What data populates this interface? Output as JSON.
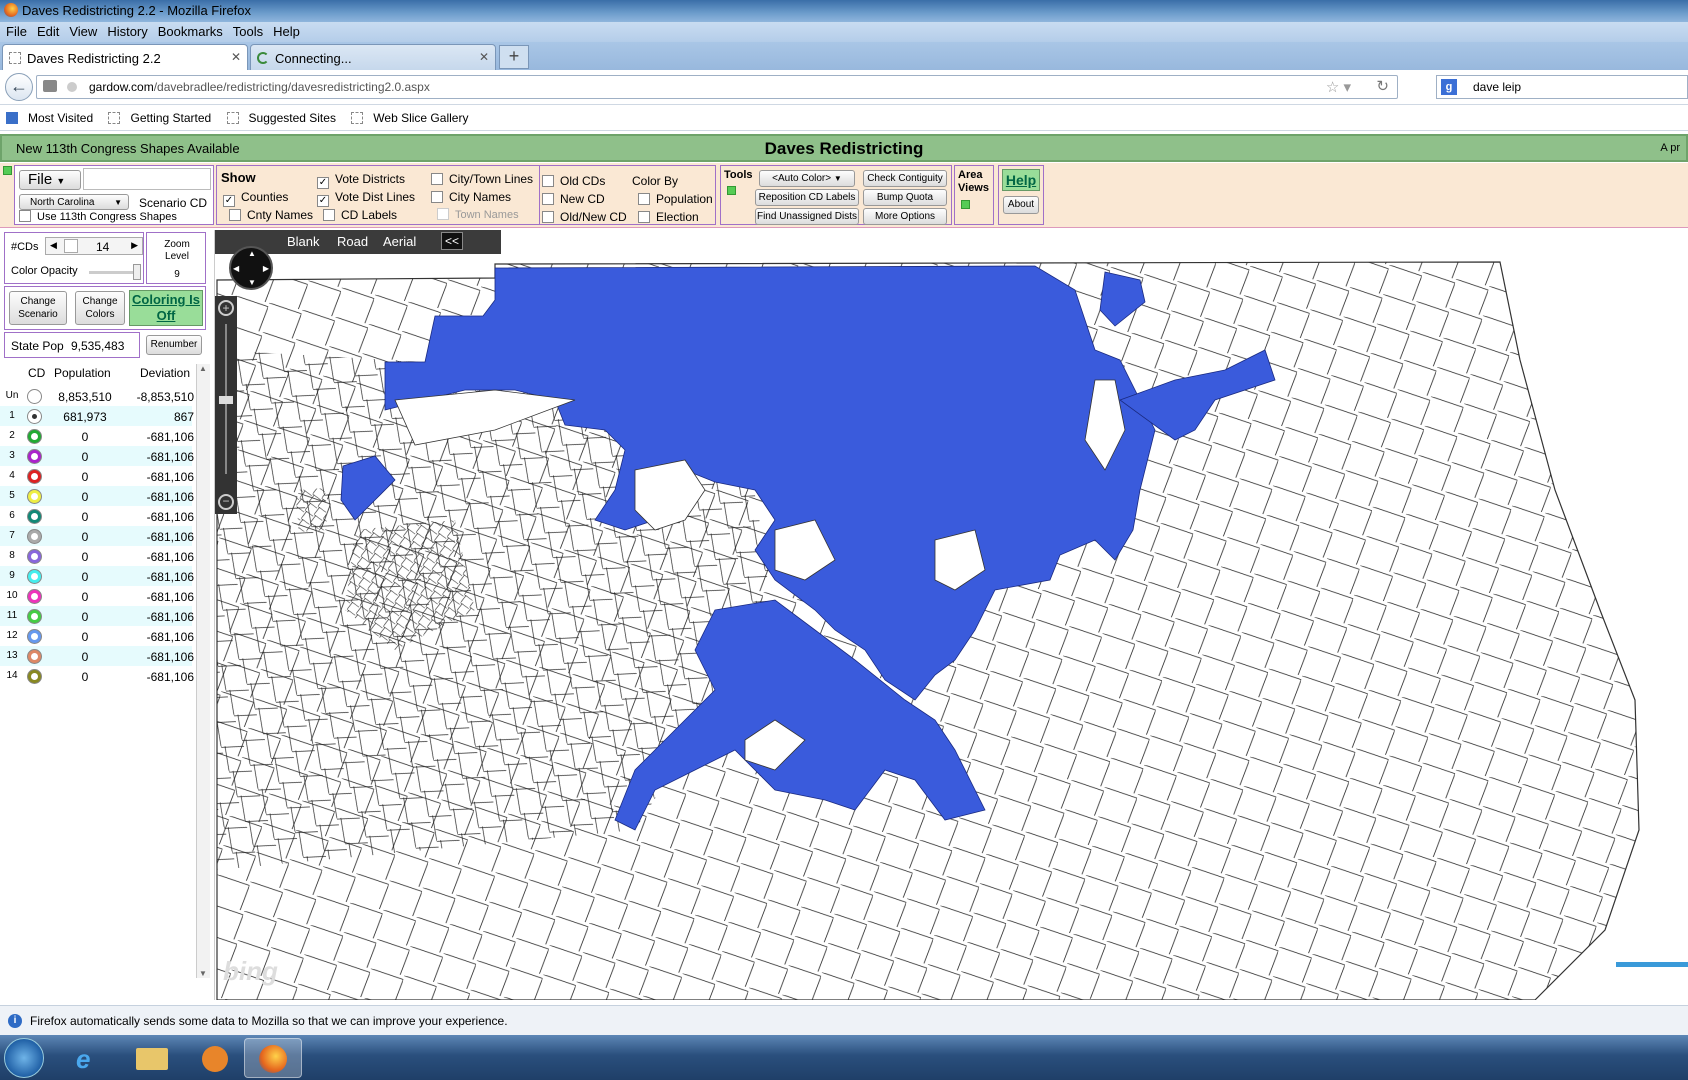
{
  "window": {
    "title": "Daves Redistricting 2.2 - Mozilla Firefox"
  },
  "menu": [
    "File",
    "Edit",
    "View",
    "History",
    "Bookmarks",
    "Tools",
    "Help"
  ],
  "tabs": [
    {
      "label": "Daves Redistricting 2.2",
      "active": true
    },
    {
      "label": "Connecting...",
      "active": false
    }
  ],
  "url": {
    "domain": "gardow.com",
    "path": "/davebradlee/redistricting/davesredistricting2.0.aspx"
  },
  "search": {
    "value": "dave leip"
  },
  "bookmarks": [
    "Most Visited",
    "Getting Started",
    "Suggested Sites",
    "Web Slice Gallery"
  ],
  "app": {
    "notice": "New 113th Congress Shapes Available",
    "title": "Daves Redistricting",
    "right_text": "A pr"
  },
  "file_panel": {
    "file_label": "File",
    "state": "North Carolina",
    "scenario": "Scenario CD",
    "use113": "Use 113th Congress Shapes"
  },
  "show_panel": {
    "title": "Show",
    "items": [
      {
        "label": "Vote Districts",
        "checked": true
      },
      {
        "label": "City/Town Lines",
        "checked": false
      },
      {
        "label": "Counties",
        "checked": true
      },
      {
        "label": "Vote Dist Lines",
        "checked": true
      },
      {
        "label": "City Names",
        "checked": false
      },
      {
        "label": "Cnty Names",
        "checked": false
      },
      {
        "label": "CD Labels",
        "checked": false
      },
      {
        "label": "Town Names",
        "checked": false
      }
    ]
  },
  "cd_panel": {
    "items": [
      {
        "label": "Old CDs",
        "checked": false
      },
      {
        "label": "New CD",
        "checked": false
      },
      {
        "label": "Old/New CD",
        "checked": false
      }
    ],
    "color_by": "Color By",
    "color_options": [
      {
        "label": "Population",
        "checked": false
      },
      {
        "label": "Election",
        "checked": false
      }
    ]
  },
  "tools": {
    "title": "Tools",
    "auto_color": "<Auto Color>",
    "check_contiguity": "Check Contiguity",
    "reposition": "Reposition CD Labels",
    "bump_quota": "Bump Quota",
    "find_unassigned": "Find Unassigned Dists",
    "more_options": "More Options"
  },
  "area_views": "Area Views",
  "help": "Help",
  "about": "About",
  "left": {
    "cds_label": "#CDs",
    "cds_value": "14",
    "zoom_label": "Zoom Level",
    "zoom_value": "9",
    "opacity_label": "Color Opacity",
    "change_scenario": "Change Scenario",
    "change_colors": "Change Colors",
    "coloring": "Coloring Is Off",
    "state_pop_label": "State Pop",
    "state_pop": "9,535,483",
    "renumber": "Renumber"
  },
  "table": {
    "headers": [
      "CD",
      "Population",
      "Deviation"
    ],
    "rows": [
      {
        "cd": "Un",
        "color": "#ffffff",
        "pop": "8,853,510",
        "dev": "-8,853,510",
        "selected": false
      },
      {
        "cd": "1",
        "color": "#3355dd",
        "pop": "681,973",
        "dev": "867",
        "selected": true
      },
      {
        "cd": "2",
        "color": "#22aa33",
        "pop": "0",
        "dev": "-681,106",
        "selected": false
      },
      {
        "cd": "3",
        "color": "#aa22cc",
        "pop": "0",
        "dev": "-681,106",
        "selected": false
      },
      {
        "cd": "4",
        "color": "#dd2222",
        "pop": "0",
        "dev": "-681,106",
        "selected": false
      },
      {
        "cd": "5",
        "color": "#eeee44",
        "pop": "0",
        "dev": "-681,106",
        "selected": false
      },
      {
        "cd": "6",
        "color": "#118877",
        "pop": "0",
        "dev": "-681,106",
        "selected": false
      },
      {
        "cd": "7",
        "color": "#aaaaaa",
        "pop": "0",
        "dev": "-681,106",
        "selected": false
      },
      {
        "cd": "8",
        "color": "#8866dd",
        "pop": "0",
        "dev": "-681,106",
        "selected": false
      },
      {
        "cd": "9",
        "color": "#44eeee",
        "pop": "0",
        "dev": "-681,106",
        "selected": false
      },
      {
        "cd": "10",
        "color": "#ee33bb",
        "pop": "0",
        "dev": "-681,106",
        "selected": false
      },
      {
        "cd": "11",
        "color": "#44cc44",
        "pop": "0",
        "dev": "-681,106",
        "selected": false
      },
      {
        "cd": "12",
        "color": "#6699ee",
        "pop": "0",
        "dev": "-681,106",
        "selected": false
      },
      {
        "cd": "13",
        "color": "#dd8866",
        "pop": "0",
        "dev": "-681,106",
        "selected": false
      },
      {
        "cd": "14",
        "color": "#888822",
        "pop": "0",
        "dev": "-681,106",
        "selected": false
      }
    ]
  },
  "map": {
    "views": [
      "Blank",
      "Road",
      "Aerial"
    ],
    "collapse": "<<",
    "district_color": "#3a5bdc",
    "attribution": "bing"
  },
  "notification": "Firefox automatically sends some data to Mozilla so that we can improve your experience."
}
